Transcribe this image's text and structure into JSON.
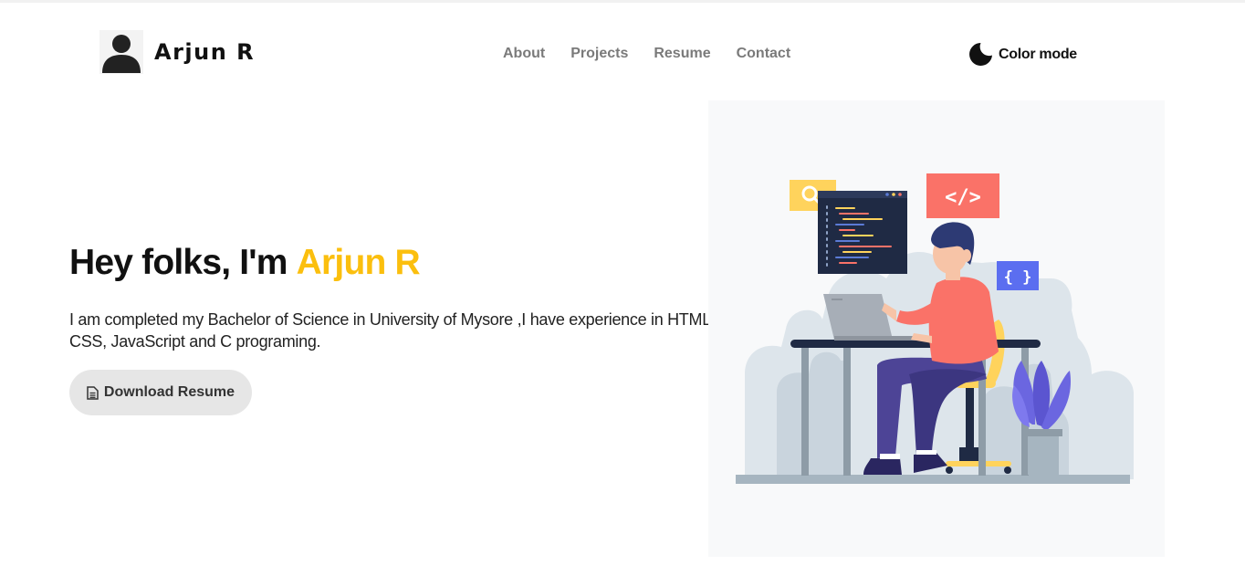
{
  "header": {
    "brand_name": "Arjun R",
    "avatar_icon": "user-silhouette-icon",
    "nav": [
      {
        "label": "About"
      },
      {
        "label": "Projects"
      },
      {
        "label": "Resume"
      },
      {
        "label": "Contact"
      }
    ],
    "color_mode_label": "Color mode",
    "color_mode_icon": "moon-icon"
  },
  "hero": {
    "greeting": "Hey folks, I'm",
    "name": "Arjun R",
    "description": "I am completed my Bachelor of Science in University of Mysore ,I have experience in HTML , CSS, JavaScript and C programing.",
    "download_label": "Download Resume",
    "download_icon": "document-icon"
  },
  "illustration": {
    "search_icon": "search-icon",
    "code_tag_label": "</>",
    "braces_label": "{ }"
  },
  "colors": {
    "accent": "#fbbf0e",
    "nav_text": "#7a7a7a",
    "button_bg": "#e6e6e6",
    "illustration_bg": "#f8f9fa"
  }
}
